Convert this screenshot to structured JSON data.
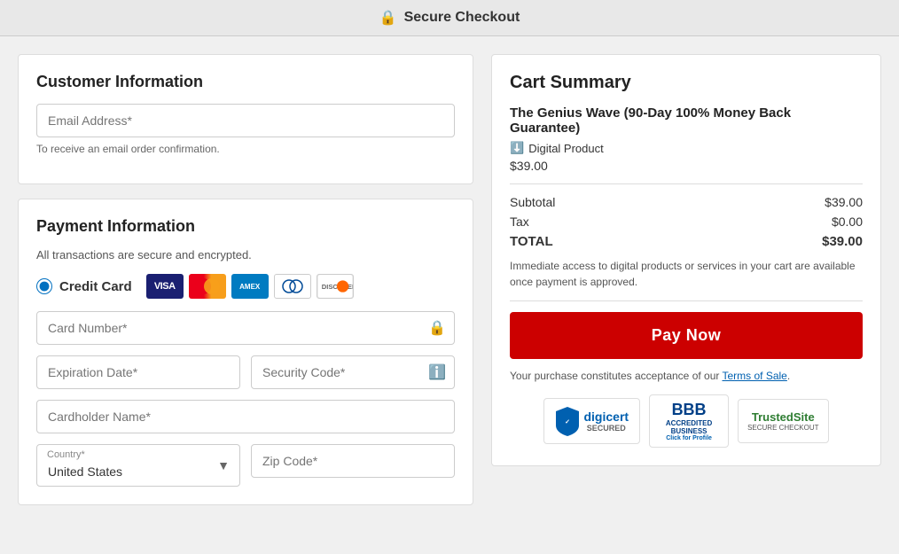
{
  "header": {
    "icon": "🔒",
    "title": "Secure Checkout"
  },
  "customer": {
    "section_title": "Customer Information",
    "email_placeholder": "Email Address*",
    "email_hint": "To receive an email order confirmation."
  },
  "payment": {
    "section_title": "Payment Information",
    "subtitle": "All transactions are secure and encrypted.",
    "method_label": "Credit Card",
    "card_number_placeholder": "Card Number*",
    "expiry_placeholder": "Expiration Date*",
    "security_placeholder": "Security Code*",
    "cardholder_placeholder": "Cardholder Name*",
    "country_label": "Country*",
    "country_value": "United States",
    "zip_placeholder": "Zip Code*"
  },
  "cart": {
    "title": "Cart Summary",
    "product_name": "The Genius Wave (90-Day 100% Money Back Guarantee)",
    "digital_label": "Digital Product",
    "product_price": "$39.00",
    "subtotal_label": "Subtotal",
    "subtotal_value": "$39.00",
    "tax_label": "Tax",
    "tax_value": "$0.00",
    "total_label": "TOTAL",
    "total_value": "$39.00",
    "access_note": "Immediate access to digital products or services in your cart are available once payment is approved.",
    "pay_button": "Pay Now",
    "terms_prefix": "Your purchase constitutes acceptance of our ",
    "terms_link": "Terms of Sale",
    "terms_suffix": ".",
    "digicert_label": "digicert",
    "digicert_sub": "SECURED",
    "bbb_line1": "BBB",
    "bbb_line2": "ACCREDITED",
    "bbb_line3": "BUSINESS",
    "bbb_line4": "Click for Profile",
    "trusted_line1": "TrustedSite",
    "trusted_line2": "SECURE CHECKOUT"
  }
}
